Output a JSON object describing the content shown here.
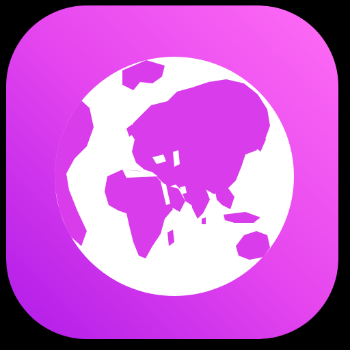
{
  "icon": {
    "name": "globe-icon",
    "colors": {
      "background": "#000000",
      "gradient_start": "#ff6cf5",
      "gradient_mid": "#e445ee",
      "gradient_end": "#b01ce8",
      "globe": "#ffffff",
      "land": "#d93cea"
    }
  }
}
